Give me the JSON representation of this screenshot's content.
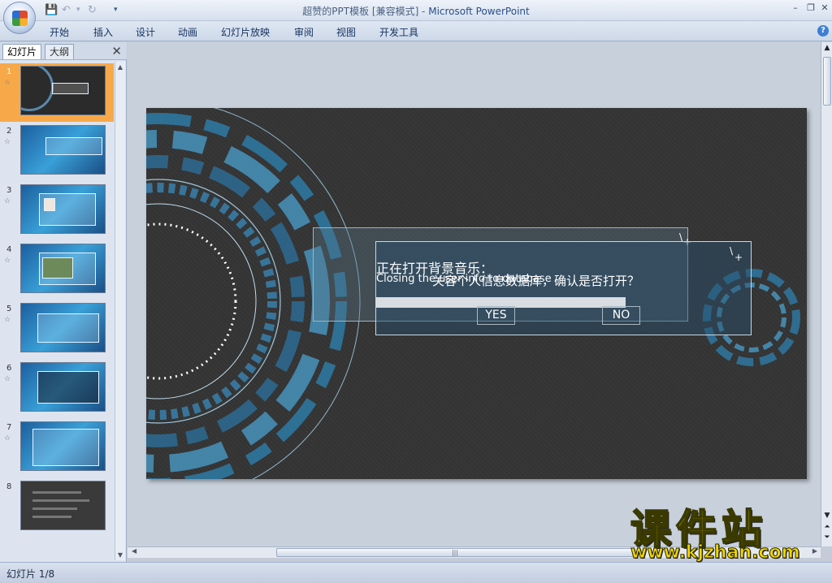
{
  "window": {
    "title_doc": "超赞的PPT模板 [兼容模式] - ",
    "title_app": "Microsoft PowerPoint",
    "minimize": "–",
    "restore": "❐",
    "close": "✕"
  },
  "ribbon": {
    "tabs": [
      "开始",
      "插入",
      "设计",
      "动画",
      "幻灯片放映",
      "审阅",
      "视图",
      "开发工具"
    ],
    "help": "?"
  },
  "left_panel": {
    "tabs": [
      "幻灯片",
      "大纲"
    ],
    "close": "✕",
    "slides": [
      {
        "number": "1",
        "style": "dark",
        "selected": true
      },
      {
        "number": "2",
        "style": "blue",
        "selected": false
      },
      {
        "number": "3",
        "style": "blue",
        "selected": false
      },
      {
        "number": "4",
        "style": "blue",
        "selected": false
      },
      {
        "number": "5",
        "style": "blue",
        "selected": false
      },
      {
        "number": "6",
        "style": "blue",
        "selected": false
      },
      {
        "number": "7",
        "style": "blue",
        "selected": false
      },
      {
        "number": "8",
        "style": "dark",
        "selected": false
      }
    ],
    "star_icon": "☆"
  },
  "slide": {
    "dialog": {
      "title": "正在打开背景音乐：",
      "line_en": "Closing the user info to database",
      "line_cn": "关容个人信息数据库，确认是否打开？",
      "yes_label": "YES",
      "no_label": "NO"
    }
  },
  "status": {
    "slide_position": "幻灯片 1/8"
  },
  "watermark": {
    "brand": "课件站",
    "url": "www.kjzhan.com"
  },
  "colors": {
    "accent_blue": "#3aa0d8",
    "slide_bg": "#333333",
    "selection": "#f7a94a",
    "watermark": "#f2d600"
  }
}
